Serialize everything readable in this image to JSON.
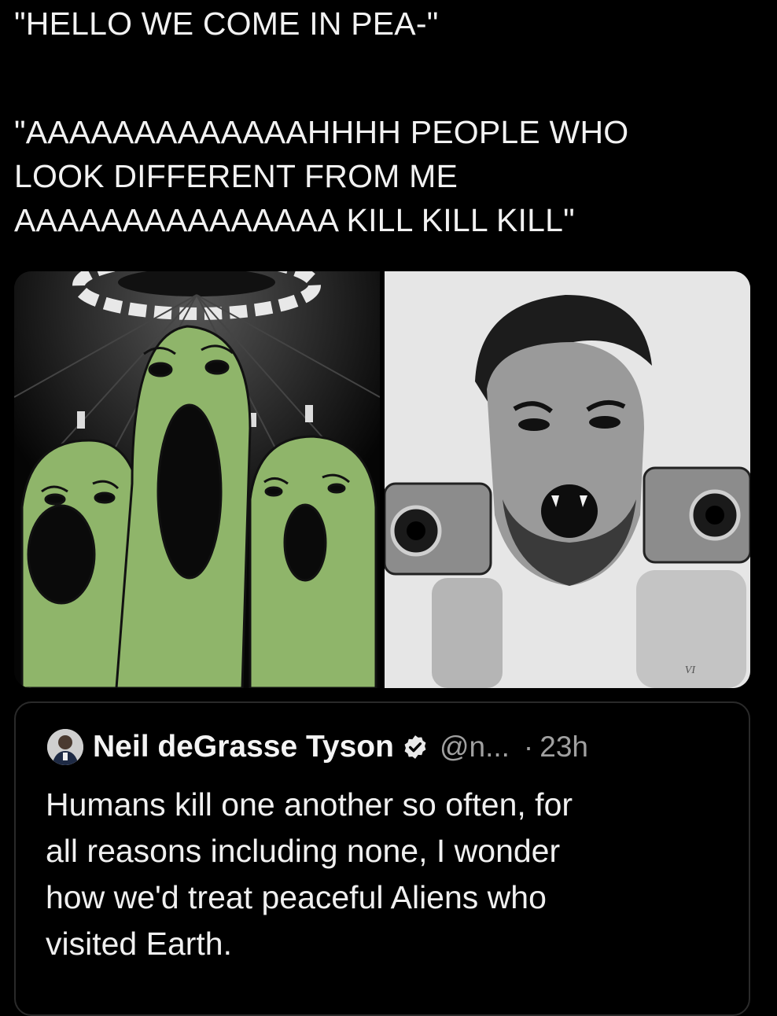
{
  "tweet": {
    "line_greeting": "\"HELLO WE COME IN PEA-\"",
    "line_scream": "\"AAAAAAAAAAAAAHHHH PEOPLE WHO\nLOOK DIFFERENT FROM ME\nAAAAAAAAAAAAAAA KILL KILL KILL\"",
    "media": {
      "left_image": "screaming-green-aliens-wojak",
      "right_image": "screaming-man-with-two-pistols",
      "watermark": "VI"
    }
  },
  "quoted_tweet": {
    "display_name": "Neil deGrasse Tyson",
    "verified": true,
    "handle": "@n...",
    "separator": "·",
    "time": "23h",
    "text": "Humans kill one another so often, for\nall reasons including none, I wonder\nhow we'd treat peaceful Aliens who\nvisited Earth."
  },
  "colors": {
    "background": "#000000",
    "text": "#f2f2f2",
    "muted": "#a0a0a0",
    "card_border": "#2a2a2a",
    "alien_green": "#8fb56a"
  }
}
